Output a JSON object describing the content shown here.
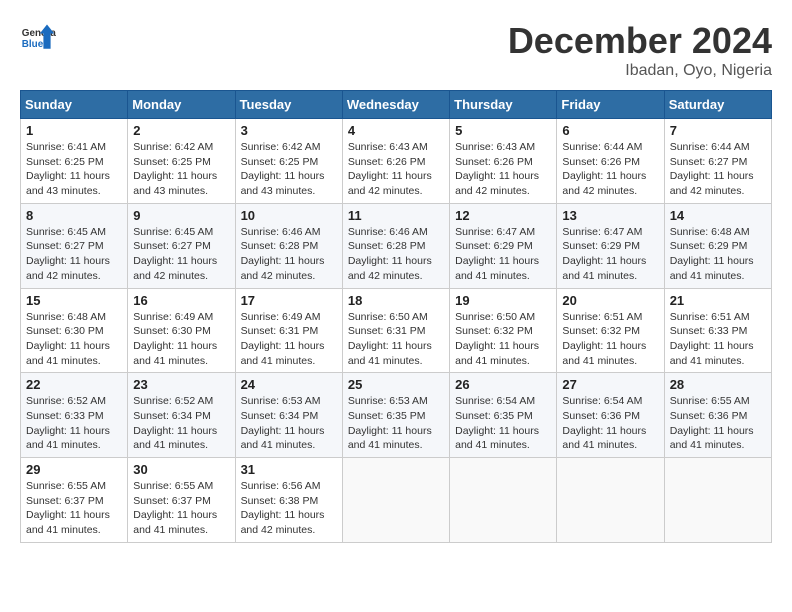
{
  "header": {
    "logo": {
      "general": "General",
      "blue": "Blue"
    },
    "title": "December 2024",
    "subtitle": "Ibadan, Oyo, Nigeria"
  },
  "calendar": {
    "columns": [
      "Sunday",
      "Monday",
      "Tuesday",
      "Wednesday",
      "Thursday",
      "Friday",
      "Saturday"
    ],
    "weeks": [
      [
        {
          "day": 1,
          "sunrise": "6:41 AM",
          "sunset": "6:25 PM",
          "daylight": "11 hours and 43 minutes."
        },
        {
          "day": 2,
          "sunrise": "6:42 AM",
          "sunset": "6:25 PM",
          "daylight": "11 hours and 43 minutes."
        },
        {
          "day": 3,
          "sunrise": "6:42 AM",
          "sunset": "6:25 PM",
          "daylight": "11 hours and 43 minutes."
        },
        {
          "day": 4,
          "sunrise": "6:43 AM",
          "sunset": "6:26 PM",
          "daylight": "11 hours and 42 minutes."
        },
        {
          "day": 5,
          "sunrise": "6:43 AM",
          "sunset": "6:26 PM",
          "daylight": "11 hours and 42 minutes."
        },
        {
          "day": 6,
          "sunrise": "6:44 AM",
          "sunset": "6:26 PM",
          "daylight": "11 hours and 42 minutes."
        },
        {
          "day": 7,
          "sunrise": "6:44 AM",
          "sunset": "6:27 PM",
          "daylight": "11 hours and 42 minutes."
        }
      ],
      [
        {
          "day": 8,
          "sunrise": "6:45 AM",
          "sunset": "6:27 PM",
          "daylight": "11 hours and 42 minutes."
        },
        {
          "day": 9,
          "sunrise": "6:45 AM",
          "sunset": "6:27 PM",
          "daylight": "11 hours and 42 minutes."
        },
        {
          "day": 10,
          "sunrise": "6:46 AM",
          "sunset": "6:28 PM",
          "daylight": "11 hours and 42 minutes."
        },
        {
          "day": 11,
          "sunrise": "6:46 AM",
          "sunset": "6:28 PM",
          "daylight": "11 hours and 42 minutes."
        },
        {
          "day": 12,
          "sunrise": "6:47 AM",
          "sunset": "6:29 PM",
          "daylight": "11 hours and 41 minutes."
        },
        {
          "day": 13,
          "sunrise": "6:47 AM",
          "sunset": "6:29 PM",
          "daylight": "11 hours and 41 minutes."
        },
        {
          "day": 14,
          "sunrise": "6:48 AM",
          "sunset": "6:29 PM",
          "daylight": "11 hours and 41 minutes."
        }
      ],
      [
        {
          "day": 15,
          "sunrise": "6:48 AM",
          "sunset": "6:30 PM",
          "daylight": "11 hours and 41 minutes."
        },
        {
          "day": 16,
          "sunrise": "6:49 AM",
          "sunset": "6:30 PM",
          "daylight": "11 hours and 41 minutes."
        },
        {
          "day": 17,
          "sunrise": "6:49 AM",
          "sunset": "6:31 PM",
          "daylight": "11 hours and 41 minutes."
        },
        {
          "day": 18,
          "sunrise": "6:50 AM",
          "sunset": "6:31 PM",
          "daylight": "11 hours and 41 minutes."
        },
        {
          "day": 19,
          "sunrise": "6:50 AM",
          "sunset": "6:32 PM",
          "daylight": "11 hours and 41 minutes."
        },
        {
          "day": 20,
          "sunrise": "6:51 AM",
          "sunset": "6:32 PM",
          "daylight": "11 hours and 41 minutes."
        },
        {
          "day": 21,
          "sunrise": "6:51 AM",
          "sunset": "6:33 PM",
          "daylight": "11 hours and 41 minutes."
        }
      ],
      [
        {
          "day": 22,
          "sunrise": "6:52 AM",
          "sunset": "6:33 PM",
          "daylight": "11 hours and 41 minutes."
        },
        {
          "day": 23,
          "sunrise": "6:52 AM",
          "sunset": "6:34 PM",
          "daylight": "11 hours and 41 minutes."
        },
        {
          "day": 24,
          "sunrise": "6:53 AM",
          "sunset": "6:34 PM",
          "daylight": "11 hours and 41 minutes."
        },
        {
          "day": 25,
          "sunrise": "6:53 AM",
          "sunset": "6:35 PM",
          "daylight": "11 hours and 41 minutes."
        },
        {
          "day": 26,
          "sunrise": "6:54 AM",
          "sunset": "6:35 PM",
          "daylight": "11 hours and 41 minutes."
        },
        {
          "day": 27,
          "sunrise": "6:54 AM",
          "sunset": "6:36 PM",
          "daylight": "11 hours and 41 minutes."
        },
        {
          "day": 28,
          "sunrise": "6:55 AM",
          "sunset": "6:36 PM",
          "daylight": "11 hours and 41 minutes."
        }
      ],
      [
        {
          "day": 29,
          "sunrise": "6:55 AM",
          "sunset": "6:37 PM",
          "daylight": "11 hours and 41 minutes."
        },
        {
          "day": 30,
          "sunrise": "6:55 AM",
          "sunset": "6:37 PM",
          "daylight": "11 hours and 41 minutes."
        },
        {
          "day": 31,
          "sunrise": "6:56 AM",
          "sunset": "6:38 PM",
          "daylight": "11 hours and 42 minutes."
        },
        null,
        null,
        null,
        null
      ]
    ]
  }
}
